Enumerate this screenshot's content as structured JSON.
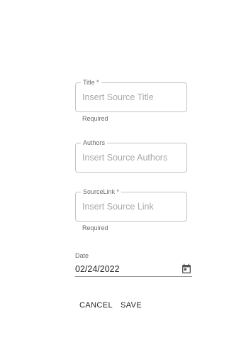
{
  "form": {
    "title_field": {
      "label": "Title *",
      "placeholder": "Insert Source Title",
      "value": "",
      "helper": "Required"
    },
    "authors_field": {
      "label": "Authors",
      "placeholder": "Insert Source Authors",
      "value": ""
    },
    "sourcelink_field": {
      "label": "SourceLink *",
      "placeholder": "Insert Source Link",
      "value": "",
      "helper": "Required"
    },
    "date_field": {
      "label": "Date",
      "value": "02/24/2022",
      "icon": "calendar-icon"
    }
  },
  "actions": {
    "cancel_label": "CANCEL",
    "save_label": "SAVE"
  }
}
